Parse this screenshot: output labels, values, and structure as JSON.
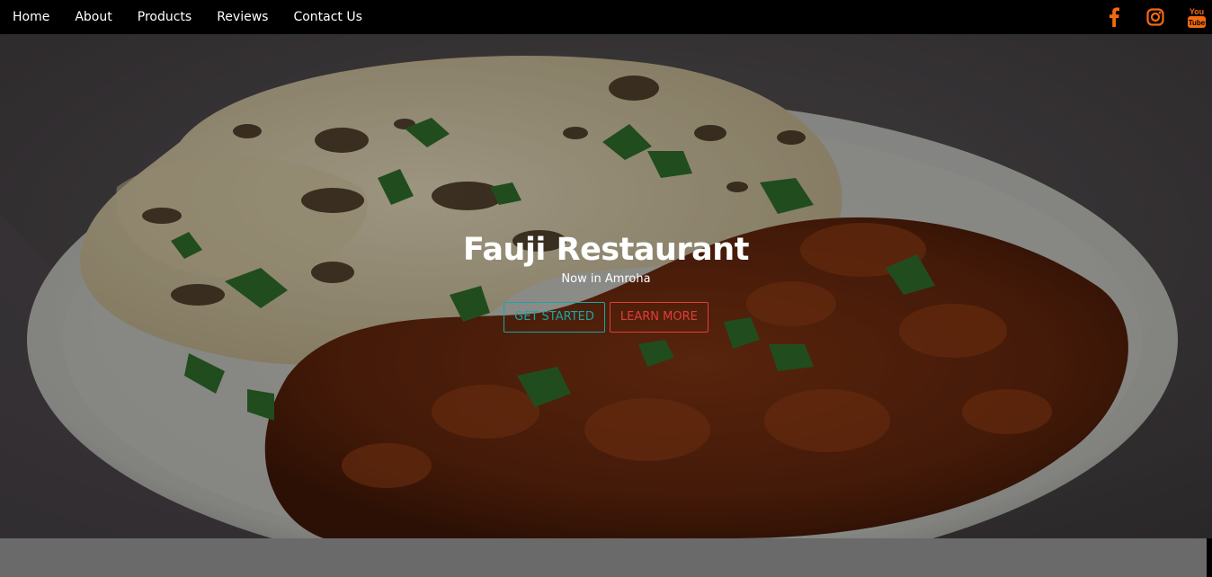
{
  "nav": {
    "links": [
      "Home",
      "About",
      "Products",
      "Reviews",
      "Contact Us"
    ]
  },
  "social": {
    "icons": [
      "facebook-icon",
      "instagram-icon",
      "youtube-icon"
    ],
    "color": "#f26a10",
    "youtube_text_top": "You",
    "youtube_text_bottom": "Tube"
  },
  "hero": {
    "title": "Fauji Restaurant",
    "subtitle": "Now in Amroha",
    "get_started_label": "GET STARTED",
    "learn_more_label": "LEARN MORE"
  },
  "colors": {
    "navbar": "#000000",
    "button_primary": "#1aa6a6",
    "button_secondary": "#e23c3c"
  }
}
